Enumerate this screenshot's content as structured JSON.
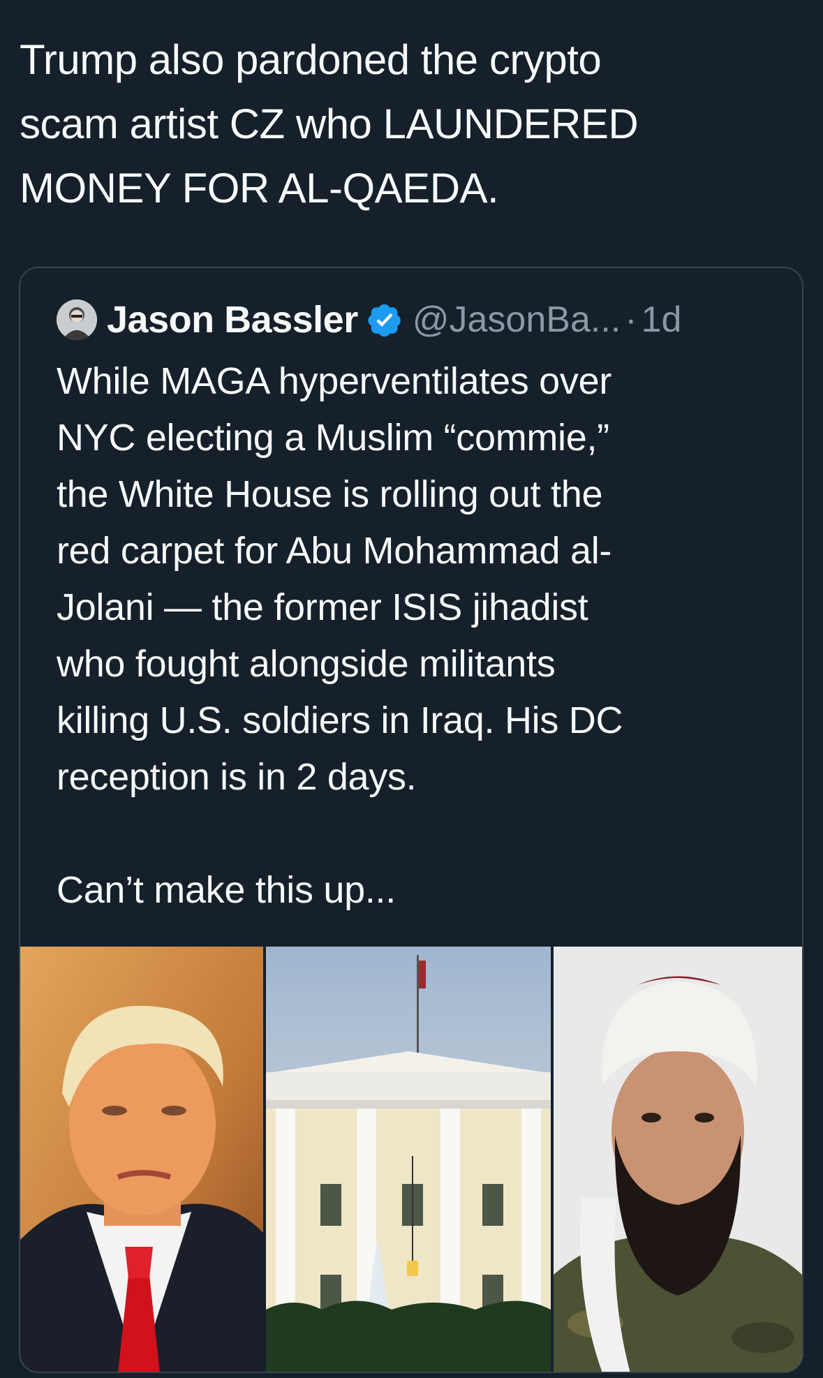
{
  "tweet": {
    "text": "Trump also pardoned the crypto\nscam artist CZ who LAUNDERED\nMONEY FOR AL-QAEDA."
  },
  "quoted_tweet": {
    "author_name": "Jason Bassler",
    "author_handle": "@JasonBa...",
    "separator": "·",
    "timestamp": "1d",
    "verified": true,
    "text": "While MAGA hyperventilates over\nNYC electing a Muslim “commie,”\nthe White House is rolling out the\nred carpet for Abu Mohammad al-\nJolani — the former ISIS jihadist\nwho fought alongside militants\nkilling U.S. soldiers in Iraq. His DC\nreception is in 2 days.\n\nCan’t make this up...",
    "media": [
      {
        "name": "trump-photo"
      },
      {
        "name": "white-house-photo"
      },
      {
        "name": "jolani-photo"
      }
    ]
  },
  "colors": {
    "background": "#15202b",
    "border": "#38444d",
    "secondary_text": "#8b98a5",
    "verified_blue": "#1d9bf0"
  }
}
